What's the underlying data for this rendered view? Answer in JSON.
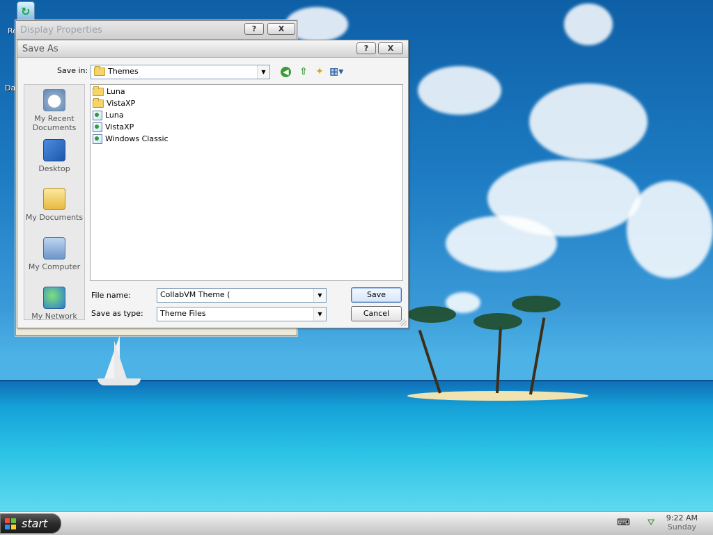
{
  "desktop": {
    "icons": [
      {
        "label": "Re"
      },
      {
        "label": "Da"
      }
    ]
  },
  "display_properties": {
    "title": "Display Properties",
    "help_label": "?",
    "close_label": "X"
  },
  "save_as": {
    "title": "Save As",
    "help_label": "?",
    "close_label": "X",
    "save_in_label": "Save in:",
    "save_in_value": "Themes",
    "places": [
      {
        "label": "My Recent Documents"
      },
      {
        "label": "Desktop"
      },
      {
        "label": "My Documents"
      },
      {
        "label": "My Computer"
      },
      {
        "label": "My Network"
      }
    ],
    "files": [
      {
        "name": "Luna",
        "type": "folder"
      },
      {
        "name": "VistaXP",
        "type": "folder"
      },
      {
        "name": "Luna",
        "type": "theme"
      },
      {
        "name": "VistaXP",
        "type": "theme"
      },
      {
        "name": "Windows Classic",
        "type": "theme"
      }
    ],
    "file_name_label": "File name:",
    "file_name_value": "CollabVM Theme (",
    "save_as_type_label": "Save as type:",
    "save_as_type_value": "Theme Files",
    "save_button": "Save",
    "cancel_button": "Cancel"
  },
  "taskbar": {
    "start_label": "start",
    "time": "9:22 AM",
    "day": "Sunday"
  }
}
